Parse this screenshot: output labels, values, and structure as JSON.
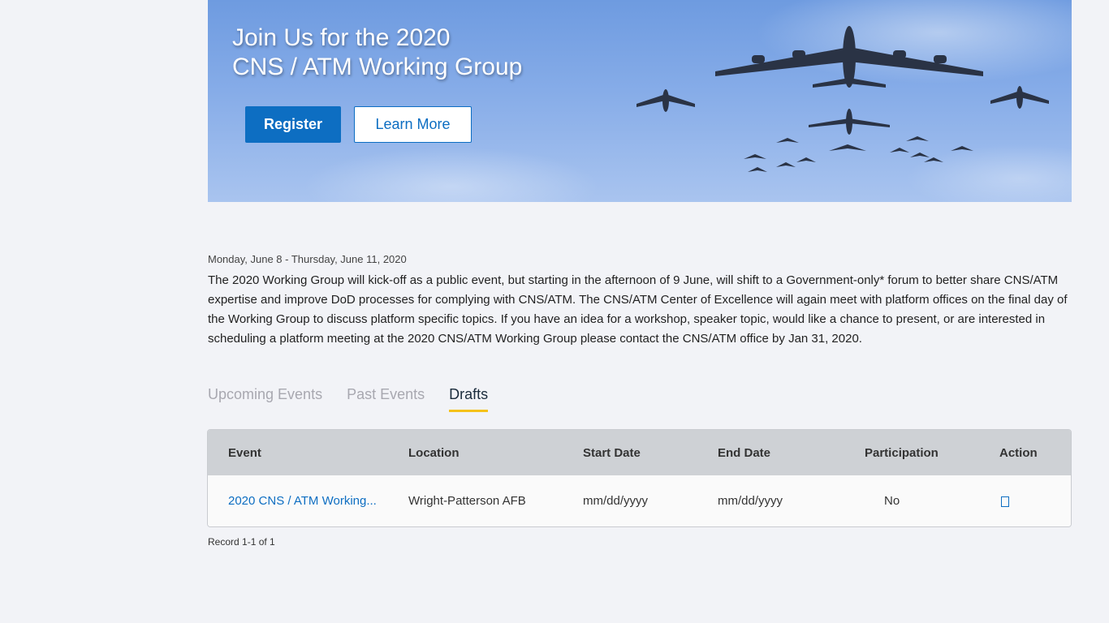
{
  "hero": {
    "title_line1": "Join Us for the 2020",
    "title_line2": "CNS / ATM Working Group",
    "register_label": "Register",
    "learn_more_label": "Learn More"
  },
  "event": {
    "date_range": "Monday, June 8 - Thursday, June 11, 2020",
    "description": "The 2020 Working Group will kick-off as a public event, but starting in the afternoon of 9 June, will shift to a Government-only* forum to better share CNS/ATM expertise and improve DoD processes for complying with CNS/ATM. The CNS/ATM Center of Excellence will again meet with platform offices on the final day of the Working Group to discuss platform specific topics. If you have an idea for a workshop, speaker topic, would like a chance to present, or are interested in scheduling a platform meeting at the 2020 CNS/ATM Working Group please contact the CNS/ATM office by Jan 31, 2020."
  },
  "tabs": [
    {
      "label": "Upcoming Events",
      "active": false
    },
    {
      "label": "Past Events",
      "active": false
    },
    {
      "label": "Drafts",
      "active": true
    }
  ],
  "table": {
    "columns": [
      "Event",
      "Location",
      "Start Date",
      "End Date",
      "Participation",
      "Action"
    ],
    "rows": [
      {
        "event": "2020 CNS / ATM Working...",
        "location": "Wright-Patterson AFB",
        "start_date": "mm/dd/yyyy",
        "end_date": "mm/dd/yyyy",
        "participation": "No",
        "action_icon": "edit-icon"
      }
    ]
  },
  "record_count": "Record 1-1 of 1",
  "colors": {
    "accent": "#0d6ec2",
    "tab_underline": "#f5c21b",
    "background": "#f2f3f7",
    "table_header": "#ced1d5"
  }
}
